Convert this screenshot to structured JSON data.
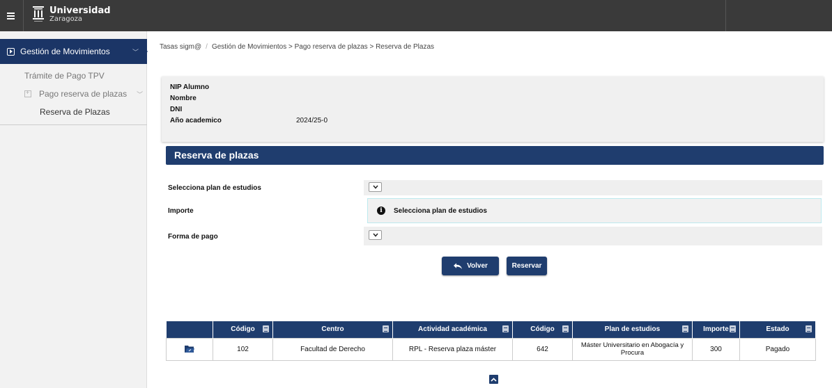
{
  "header": {
    "brand_line1": "Universidad",
    "brand_line2": "Zaragoza"
  },
  "sidebar": {
    "main_item": "Gestión de Movimientos",
    "items": [
      {
        "label": "Trámite de Pago TPV"
      },
      {
        "label": "Pago reserva de plazas"
      },
      {
        "label": "Reserva de Plazas"
      }
    ]
  },
  "breadcrumb": {
    "root": "Tasas sigm@",
    "sep": "/",
    "path": "Gestión de Movimientos > Pago reserva de plazas > Reserva de Plazas"
  },
  "info": {
    "nip_label": "NIP Alumno",
    "nombre_label": "Nombre",
    "dni_label": "DNI",
    "anio_label": "Año academico",
    "anio_value": "2024/25-0"
  },
  "panel": {
    "title": "Reserva de plazas"
  },
  "form": {
    "plan_label": "Selecciona plan de estudios",
    "importe_label": "Importe",
    "importe_notice": "Selecciona plan de estudios",
    "forma_label": "Forma de pago"
  },
  "buttons": {
    "volver": "Volver",
    "reservar": "Reservar"
  },
  "table": {
    "headers": [
      "",
      "Código",
      "Centro",
      "Actividad académica",
      "Código",
      "Plan de estudios",
      "Importe",
      "Estado"
    ],
    "rows": [
      {
        "icon": "folder-open-icon",
        "codigo1": "102",
        "centro": "Facultad de Derecho",
        "actividad": "RPL - Reserva plaza máster",
        "codigo2": "642",
        "plan": "Máster Universitario en Abogacía y Procura",
        "importe": "300",
        "estado": "Pagado"
      }
    ]
  },
  "colors": {
    "primary": "#1f3d6e",
    "topbar": "#3a3a3a",
    "sidebar_active": "#1b3566"
  }
}
